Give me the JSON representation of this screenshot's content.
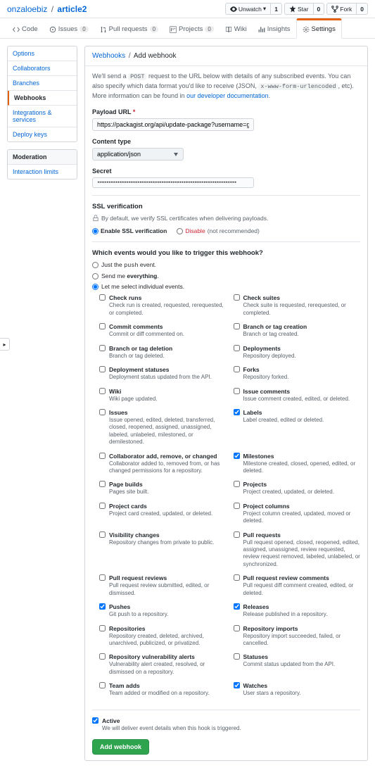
{
  "breadcrumb": {
    "owner": "onzaloebiz",
    "repo": "article2"
  },
  "header_buttons": {
    "unwatch": "Unwatch",
    "unwatch_count": "1",
    "star": "Star",
    "star_count": "0",
    "fork": "Fork",
    "fork_count": "0"
  },
  "tabs": {
    "code": "Code",
    "issues": "Issues",
    "issues_count": "0",
    "pulls": "Pull requests",
    "pulls_count": "0",
    "projects": "Projects",
    "projects_count": "0",
    "wiki": "Wiki",
    "insights": "Insights",
    "settings": "Settings"
  },
  "sidebar": {
    "items": [
      {
        "label": "Options"
      },
      {
        "label": "Collaborators"
      },
      {
        "label": "Branches"
      },
      {
        "label": "Webhooks"
      },
      {
        "label": "Integrations & services"
      },
      {
        "label": "Deploy keys"
      }
    ],
    "moderation_header": "Moderation",
    "moderation": [
      {
        "label": "Interaction limits"
      }
    ]
  },
  "subhead": {
    "root": "Webhooks",
    "current": "Add webhook"
  },
  "help": {
    "p1a": "We'll send a ",
    "code1": "POST",
    "p1b": " request to the URL below with details of any subscribed events. You can also specify which data format you'd like to receive (JSON, ",
    "code2": "x-www-form-urlencoded",
    "p1c": ", etc). More information can be found in ",
    "link": "our developer documentation",
    "p1d": "."
  },
  "form": {
    "payload_label": "Payload URL",
    "payload_value": "https://packagist.org/api/update-package?username=gonzalouy=Gvl",
    "content_label": "Content type",
    "content_value": "application/json",
    "secret_label": "Secret",
    "secret_value": "••••••••••••••••••••••••••••••••••••••••••••••••••••••••••••••••••••••••••••"
  },
  "ssl": {
    "title": "SSL verification",
    "note": "By default, we verify SSL certificates when delivering payloads.",
    "enable": "Enable SSL verification",
    "disable": "Disable",
    "disable_note": "(not recommended)"
  },
  "trigger": {
    "question": "Which events would you like to trigger this webhook?",
    "opt_push_a": "Just the ",
    "opt_push_code": "push",
    "opt_push_b": " event.",
    "opt_all_a": "Send me ",
    "opt_all_b": "everything",
    "opt_all_c": ".",
    "opt_select": "Let me select individual events."
  },
  "events_left": [
    {
      "label": "Check runs",
      "desc": "Check run is created, requested, rerequested, or completed.",
      "checked": false
    },
    {
      "label": "Commit comments",
      "desc": "Commit or diff commented on.",
      "checked": false
    },
    {
      "label": "Branch or tag deletion",
      "desc": "Branch or tag deleted.",
      "checked": false
    },
    {
      "label": "Deployment statuses",
      "desc": "Deployment status updated from the API.",
      "checked": false
    },
    {
      "label": "Wiki",
      "desc": "Wiki page updated.",
      "checked": false
    },
    {
      "label": "Issues",
      "desc": "Issue opened, edited, deleted, transferred, closed, reopened, assigned, unassigned, labeled, unlabeled, milestoned, or demilestoned.",
      "checked": false
    },
    {
      "label": "Collaborator add, remove, or changed",
      "desc": "Collaborator added to, removed from, or has changed permissions for a repository.",
      "checked": false
    },
    {
      "label": "Page builds",
      "desc": "Pages site built.",
      "checked": false
    },
    {
      "label": "Project cards",
      "desc": "Project card created, updated, or deleted.",
      "checked": false
    },
    {
      "label": "Visibility changes",
      "desc": "Repository changes from private to public.",
      "checked": false
    },
    {
      "label": "Pull request reviews",
      "desc": "Pull request review submitted, edited, or dismissed.",
      "checked": false
    },
    {
      "label": "Pushes",
      "desc": "Git push to a repository.",
      "checked": true
    },
    {
      "label": "Repositories",
      "desc": "Repository created, deleted, archived, unarchived, publicized, or privatized.",
      "checked": false
    },
    {
      "label": "Repository vulnerability alerts",
      "desc": "Vulnerability alert created, resolved, or dismissed on a repository.",
      "checked": false
    },
    {
      "label": "Team adds",
      "desc": "Team added or modified on a repository.",
      "checked": false
    }
  ],
  "events_right": [
    {
      "label": "Check suites",
      "desc": "Check suite is requested, rerequested, or completed.",
      "checked": false
    },
    {
      "label": "Branch or tag creation",
      "desc": "Branch or tag created.",
      "checked": false
    },
    {
      "label": "Deployments",
      "desc": "Repository deployed.",
      "checked": false
    },
    {
      "label": "Forks",
      "desc": "Repository forked.",
      "checked": false
    },
    {
      "label": "Issue comments",
      "desc": "Issue comment created, edited, or deleted.",
      "checked": false
    },
    {
      "label": "Labels",
      "desc": "Label created, edited or deleted.",
      "checked": true
    },
    {
      "label": "Milestones",
      "desc": "Milestone created, closed, opened, edited, or deleted.",
      "checked": true
    },
    {
      "label": "Projects",
      "desc": "Project created, updated, or deleted.",
      "checked": false
    },
    {
      "label": "Project columns",
      "desc": "Project column created, updated, moved or deleted.",
      "checked": false
    },
    {
      "label": "Pull requests",
      "desc": "Pull request opened, closed, reopened, edited, assigned, unassigned, review requested, review request removed, labeled, unlabeled, or synchronized.",
      "checked": false
    },
    {
      "label": "Pull request review comments",
      "desc": "Pull request diff comment created, edited, or deleted.",
      "checked": false
    },
    {
      "label": "Releases",
      "desc": "Release published in a repository.",
      "checked": true
    },
    {
      "label": "Repository imports",
      "desc": "Repository import succeeded, failed, or cancelled.",
      "checked": false
    },
    {
      "label": "Statuses",
      "desc": "Commit status updated from the API.",
      "checked": false
    },
    {
      "label": "Watches",
      "desc": "User stars a repository.",
      "checked": true
    }
  ],
  "active": {
    "label": "Active",
    "desc": "We will deliver event details when this hook is triggered.",
    "checked": true
  },
  "submit": "Add webhook"
}
